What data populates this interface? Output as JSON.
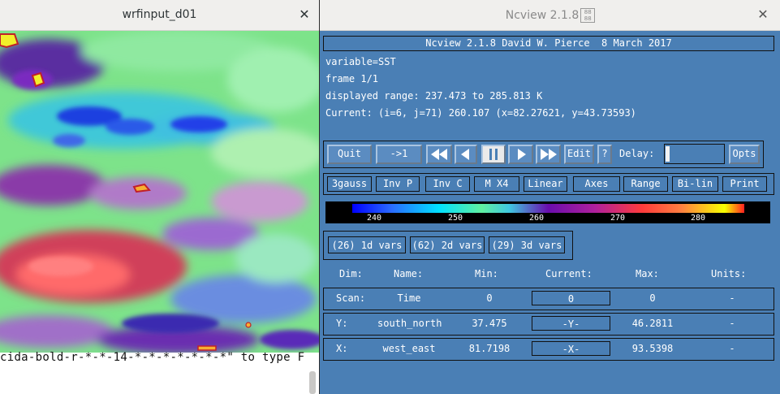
{
  "left_window": {
    "title": "wrfinput_d01",
    "terminal_text": "cida-bold-r-*-*-14-*-*-*-*-*-*-*\" to type F"
  },
  "right_window": {
    "title": "Ncview 2.1.8",
    "banner": "Ncview 2.1.8 David W. Pierce  8 March 2017",
    "info": {
      "variable": "variable=SST",
      "frame": "frame 1/1",
      "range": "displayed range: 237.473 to 285.813 K",
      "current": "Current: (i=6, j=71) 260.107 (x=82.27621, y=43.73593)"
    },
    "controls": {
      "quit": "Quit",
      "first": "->1",
      "edit": "Edit",
      "help": "?",
      "delay_label": "Delay:",
      "opts": "Opts"
    },
    "options": [
      "3gauss",
      "Inv P",
      "Inv C",
      "M X4",
      "Linear",
      "Axes",
      "Range",
      "Bi-lin",
      "Print"
    ],
    "colorbar": {
      "ticks": [
        "240",
        "250",
        "260",
        "270",
        "280"
      ],
      "colors": [
        "#0000ff",
        "#00e0ff",
        "#6a0dad",
        "#ff3b3b",
        "#f7ff00"
      ]
    },
    "var_buttons": [
      "(26) 1d vars",
      "(62) 2d vars",
      "(29) 3d vars"
    ],
    "dim_table": {
      "headers": [
        "Dim:",
        "Name:",
        "Min:",
        "Current:",
        "Max:",
        "Units:"
      ],
      "rows": [
        {
          "dim": "Scan:",
          "name": "Time",
          "min": "0",
          "current": "0",
          "max": "0",
          "units": "-"
        },
        {
          "dim": "Y:",
          "name": "south_north",
          "min": "37.475",
          "current": "-Y-",
          "max": "46.2811",
          "units": "-"
        },
        {
          "dim": "X:",
          "name": "west_east",
          "min": "81.7198",
          "current": "-X-",
          "max": "93.5398",
          "units": "-"
        }
      ]
    }
  }
}
